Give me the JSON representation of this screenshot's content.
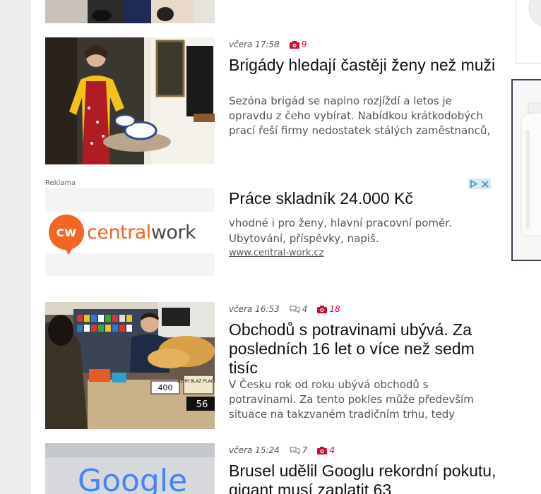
{
  "articles": [
    {
      "time": "včera 17:58",
      "photos": "9",
      "comments": null,
      "headline": "Brigády hledají častěji ženy než muži",
      "perex": "Sezóna brigád se naplno rozjíždí a letos je opravdu z čeho vybírat. Nabídkou krátkodobých prací řeší firmy nedostatek stálých zaměstnanců,"
    },
    {
      "time": "včera 16:53",
      "comments": "4",
      "photos": "18",
      "headline": "Obchodů s potravinami ubývá. Za posledních 16 let o více než sedm tisíc",
      "perex": "V Česku rok od roku ubývá obchodů s potravinami. Za tento pokles může především situace na takzvaném tradičním trhu, tedy"
    },
    {
      "time": "včera 15:24",
      "comments": "7",
      "photos": "4",
      "headline": "Brusel udělil Googlu rekordní pokutu, gigant musí zaplatit 63",
      "perex": ""
    }
  ],
  "ad": {
    "label": "Reklama",
    "logo_badge": "cw",
    "logo_word_a": "central",
    "logo_word_b": "work",
    "headline": "Práce skladník 24.000 Kč",
    "text": "vhodné i pro ženy, hlavní pracovní poměr. Ubytování, příspěvky, napiš.",
    "url": "www.central-work.cz"
  },
  "images": {
    "google_logo": "Google",
    "shop_price_a": "400",
    "shop_price_b": "56",
    "shop_price_c": "ŽEHR BLAZ PLACKA"
  },
  "colors": {
    "photo_icon": "#c8102e",
    "ad_orange": "#f26522",
    "ad_gray": "#4a4a4a"
  }
}
